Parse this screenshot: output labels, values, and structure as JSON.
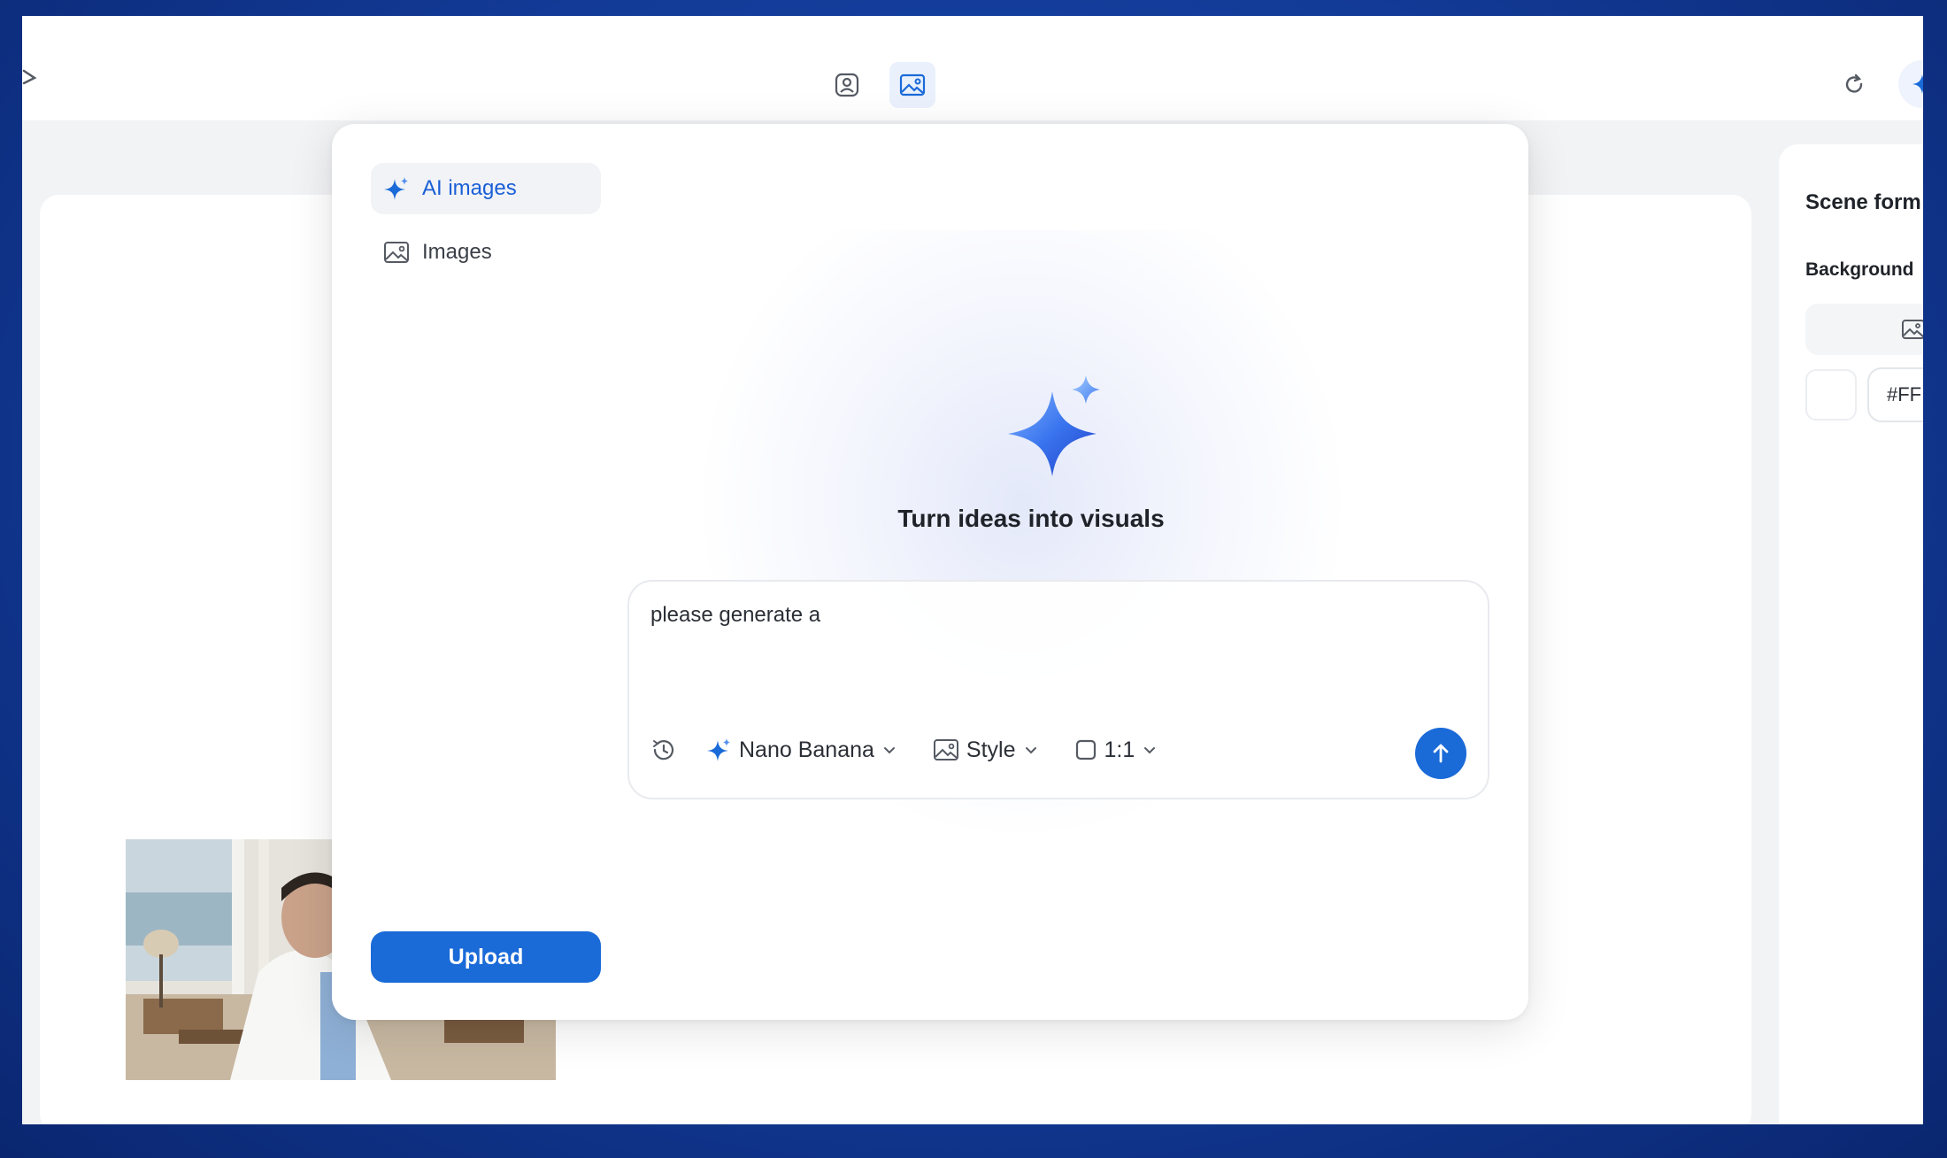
{
  "topbar": {
    "icons": [
      "back-icon",
      "person-card-icon",
      "image-icon",
      "refresh-icon",
      "sparkle-icon"
    ]
  },
  "modal": {
    "sidebar": {
      "items": [
        {
          "label": "AI images",
          "icon": "sparkle-icon",
          "active": true
        },
        {
          "label": "Images",
          "icon": "image-icon",
          "active": false
        }
      ],
      "upload_label": "Upload"
    },
    "hero": {
      "title": "Turn ideas into visuals"
    },
    "prompt": {
      "value": "please generate a",
      "model_label": "Nano Banana",
      "style_label": "Style",
      "ratio_label": "1:1"
    }
  },
  "right_panel": {
    "title": "Scene form",
    "background_label": "Background",
    "hex_value": "#FF"
  },
  "colors": {
    "accent": "#1a6ad8",
    "frame_blue": "#123a96",
    "active_text": "#1a5fd6"
  }
}
